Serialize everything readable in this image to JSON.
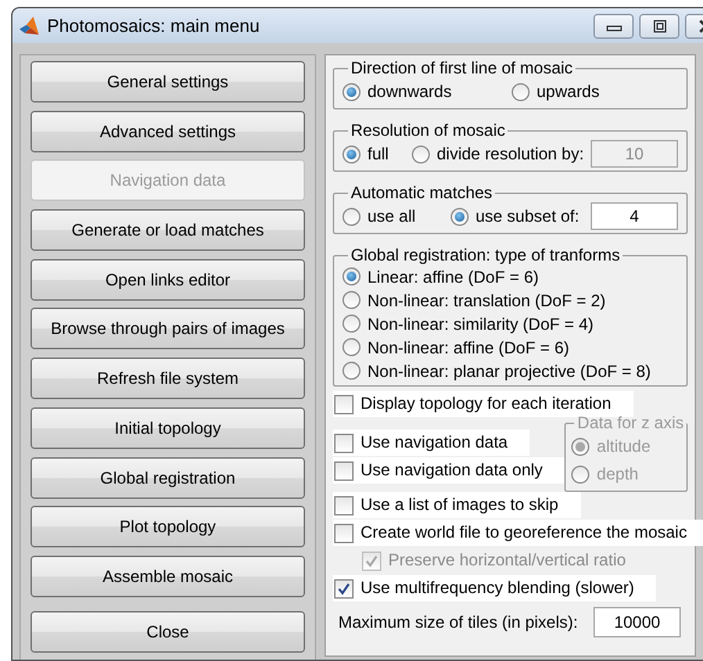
{
  "window": {
    "title": "Photomosaics: main menu"
  },
  "menu_buttons": [
    {
      "label": "General settings",
      "disabled": false
    },
    {
      "label": "Advanced settings",
      "disabled": false
    },
    {
      "label": "Navigation data",
      "disabled": true
    },
    {
      "label": "Generate or load matches",
      "disabled": false
    },
    {
      "label": "Open links editor",
      "disabled": false
    },
    {
      "label": "Browse through pairs of images",
      "disabled": false
    },
    {
      "label": "Refresh file system",
      "disabled": false
    },
    {
      "label": "Initial topology",
      "disabled": false
    },
    {
      "label": "Global registration",
      "disabled": false
    },
    {
      "label": "Plot topology",
      "disabled": false
    },
    {
      "label": "Assemble mosaic",
      "disabled": false
    },
    {
      "label": "Close",
      "disabled": false
    }
  ],
  "direction": {
    "title": "Direction of first line of mosaic",
    "options": [
      {
        "label": "downwards",
        "selected": true
      },
      {
        "label": "upwards",
        "selected": false
      }
    ]
  },
  "resolution": {
    "title": "Resolution of mosaic",
    "options": [
      {
        "label": "full",
        "selected": true
      },
      {
        "label": "divide resolution by:",
        "selected": false
      }
    ],
    "field": {
      "value": "10",
      "disabled": true
    }
  },
  "automatic_matches": {
    "title": "Automatic matches",
    "options": [
      {
        "label": "use all",
        "selected": false
      },
      {
        "label": "use subset of:",
        "selected": true
      }
    ],
    "field": {
      "value": "4",
      "disabled": false
    }
  },
  "global_registration": {
    "title": "Global registration: type of tranforms",
    "options": [
      {
        "label": "Linear: affine (DoF = 6)",
        "selected": true
      },
      {
        "label": "Non-linear: translation (DoF = 2)",
        "selected": false
      },
      {
        "label": "Non-linear: similarity (DoF = 4)",
        "selected": false
      },
      {
        "label": "Non-linear: affine (DoF = 6)",
        "selected": false
      },
      {
        "label": "Non-linear: planar projective (DoF = 8)",
        "selected": false
      }
    ]
  },
  "display_topology": {
    "label": "Display topology for each iteration",
    "checked": false,
    "disabled": false
  },
  "navigation_options": [
    {
      "label": "Use navigation data",
      "checked": false,
      "disabled": false
    },
    {
      "label": "Use navigation data only",
      "checked": false,
      "disabled": false
    }
  ],
  "z_axis": {
    "title": "Data for z axis",
    "disabled": true,
    "options": [
      {
        "label": "altitude",
        "selected": true
      },
      {
        "label": "depth",
        "selected": false
      }
    ]
  },
  "options": [
    {
      "label": "Use a list of images to skip",
      "checked": false,
      "disabled": false
    },
    {
      "label": "Create world file to georeference the mosaic",
      "checked": false,
      "disabled": false,
      "children": [
        {
          "label": "Preserve horizontal/vertical ratio",
          "checked": true,
          "disabled": true
        }
      ]
    },
    {
      "label": "Use multifrequency blending (slower)",
      "checked": true,
      "disabled": false
    }
  ],
  "max_tile_size": {
    "label": "Maximum size of tiles (in pixels):",
    "value": "10000"
  }
}
